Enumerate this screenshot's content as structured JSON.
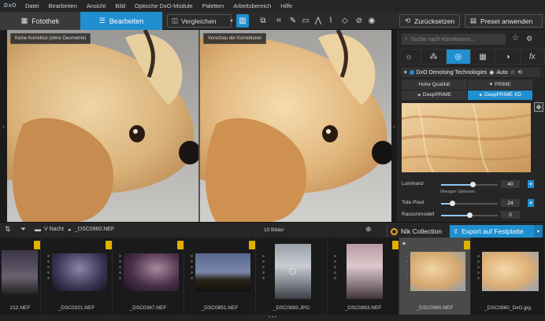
{
  "app": {
    "logo": "DxO"
  },
  "menu": [
    "Datei",
    "Bearbeiten",
    "Ansicht",
    "Bild",
    "Optische DxO-Module",
    "Paletten",
    "Arbeitsbereich",
    "Hilfe"
  ],
  "toolbar": {
    "tab_library": "Fotothek",
    "tab_edit": "Bearbeiten",
    "compare": "Vergleichen",
    "reset": "Zurücksetzen",
    "apply_preset": "Preset anwenden"
  },
  "viewer": {
    "left_label": "Keine Korrektur (ohne Geometrie)",
    "right_label": "Vorschau der Korrekturen"
  },
  "panel": {
    "search_placeholder": "Suche nach Korrekturen...",
    "module_title": "DxO Denoising Technologies",
    "auto": "Auto",
    "options": [
      {
        "label": "Hohe Qualität",
        "icon": "",
        "selected": false
      },
      {
        "label": "PRIME",
        "icon": "✦",
        "selected": false
      },
      {
        "label": "DeepPRIME",
        "icon": "✦",
        "selected": false
      },
      {
        "label": "DeepPRIME XD",
        "icon": "✦",
        "selected": true
      }
    ],
    "luminance_label": "Luminanz",
    "luminance_value": "40",
    "luminance_level": 0.55,
    "fewer_options": "Weniger Optionen",
    "dead_pixels_label": "Tote Pixel",
    "dead_pixels_value": "24",
    "dead_pixels_level": 0.2,
    "noise_model_label": "Rauschmodell",
    "noise_model_value": "0",
    "noise_model_level": 0.5
  },
  "filmbar": {
    "folder": "V Nacht",
    "filename": "_DSC0960.NEF",
    "count": "10 Bilder",
    "nik": "Nik Collection",
    "export": "Export auf Festplatte"
  },
  "thumbnails": [
    {
      "name": "212.NEF",
      "selected": false
    },
    {
      "name": "_DSC0321.NEF",
      "selected": false
    },
    {
      "name": "_DSC0367.NEF",
      "selected": false
    },
    {
      "name": "_DSC0851.NEF",
      "selected": false
    },
    {
      "name": "_DSC0883.JPG",
      "selected": false
    },
    {
      "name": "_DSC0883.NEF",
      "selected": false
    },
    {
      "name": "_DSC0960.NEF",
      "selected": true
    },
    {
      "name": "_DSC0960_DxO.jpg",
      "selected": false
    }
  ],
  "colors": {
    "accent": "#1f8fd0",
    "badge": "#e2b100"
  }
}
